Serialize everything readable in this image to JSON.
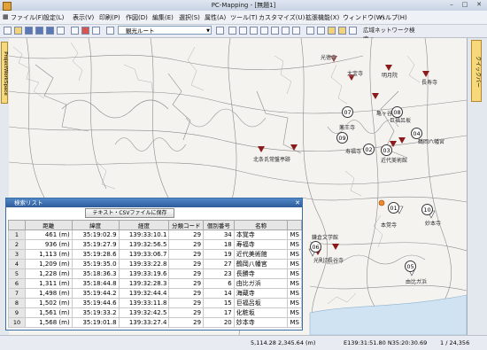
{
  "window": {
    "title": "PC-Mapping - [無題1]"
  },
  "menu": [
    "ファイル(F)",
    "設定(L)",
    "表示(V)",
    "印刷(P)",
    "作図(D)",
    "編集(E)",
    "選択(S)",
    "属性(A)",
    "ツール(T)",
    "カスタマイズ(U)",
    "拡張機能(X)",
    "ウィンドウ(W)",
    "ヘルプ(H)"
  ],
  "toolbar": {
    "route_select_value": "観光ルート",
    "net_search_label": "広域ネットワーク検索"
  },
  "left_panel": {
    "tab_label": "ProjectWorkSpace"
  },
  "right_panel": {
    "tab_label": "クイックバー"
  },
  "map": {
    "labels": [
      "光徳寺",
      "大宝寺",
      "明月院",
      "浄智寺",
      "長寿寺",
      "鶴岡八幡宮",
      "浄光明寺",
      "薬王寺",
      "亀ヶ谷",
      "巨福呂坂",
      "寿福寺",
      "英勝寺",
      "扇ヶ谷",
      "円応寺",
      "近代美術館",
      "北条氏常盤亭跡",
      "教恩寺",
      "本覚寺",
      "妙本寺",
      "由比ガ浜",
      "光則寺",
      "長谷寺",
      "鎌倉文学館",
      "海蔵寺",
      "化粧坂"
    ],
    "circles": [
      "07",
      "08",
      "09",
      "02",
      "03",
      "04",
      "01",
      "10",
      "06",
      "05"
    ]
  },
  "search_list": {
    "title": "検索リスト",
    "csv_button": "テキスト・CSVファイルに保存",
    "columns": [
      "",
      "距離",
      "緯度",
      "経度",
      "分類コード",
      "個別番号",
      "名称",
      ""
    ],
    "rows": [
      [
        "1",
        "461 (m)",
        "35:19:02.9",
        "139:33:10.1",
        "29",
        "34",
        "本覚寺",
        "MS"
      ],
      [
        "2",
        "936 (m)",
        "35:19:27.9",
        "139:32:56.5",
        "29",
        "18",
        "寿福寺",
        "MS"
      ],
      [
        "3",
        "1,113 (m)",
        "35:19:28.6",
        "139:33:06.7",
        "29",
        "19",
        "近代美術館",
        "MS"
      ],
      [
        "4",
        "1,209 (m)",
        "35:19:35.0",
        "139:33:22.8",
        "29",
        "27",
        "鶴岡八幡宮",
        "MS"
      ],
      [
        "5",
        "1,228 (m)",
        "35:18:36.3",
        "139:33:19.6",
        "29",
        "23",
        "長勝寺",
        "MS"
      ],
      [
        "6",
        "1,311 (m)",
        "35:18:44.8",
        "139:32:28.3",
        "29",
        "6",
        "由比ガ浜",
        "MS"
      ],
      [
        "7",
        "1,498 (m)",
        "35:19:44.2",
        "139:32:44.4",
        "29",
        "14",
        "海蔵寺",
        "MS"
      ],
      [
        "8",
        "1,502 (m)",
        "35:19:44.6",
        "139:33:11.8",
        "29",
        "15",
        "巨福呂坂",
        "MS"
      ],
      [
        "9",
        "1,561 (m)",
        "35:19:33.2",
        "139:32:42.5",
        "29",
        "17",
        "化粧坂",
        "MS"
      ],
      [
        "10",
        "1,568 (m)",
        "35:19:01.8",
        "139:33:27.4",
        "29",
        "20",
        "妙本寺",
        "MS"
      ]
    ]
  },
  "status": {
    "coords": "5,114.28 2,345.64 (m)",
    "latlon": "E139:31:51.80 N35:20:30.69",
    "page": "1 / 24,356"
  }
}
